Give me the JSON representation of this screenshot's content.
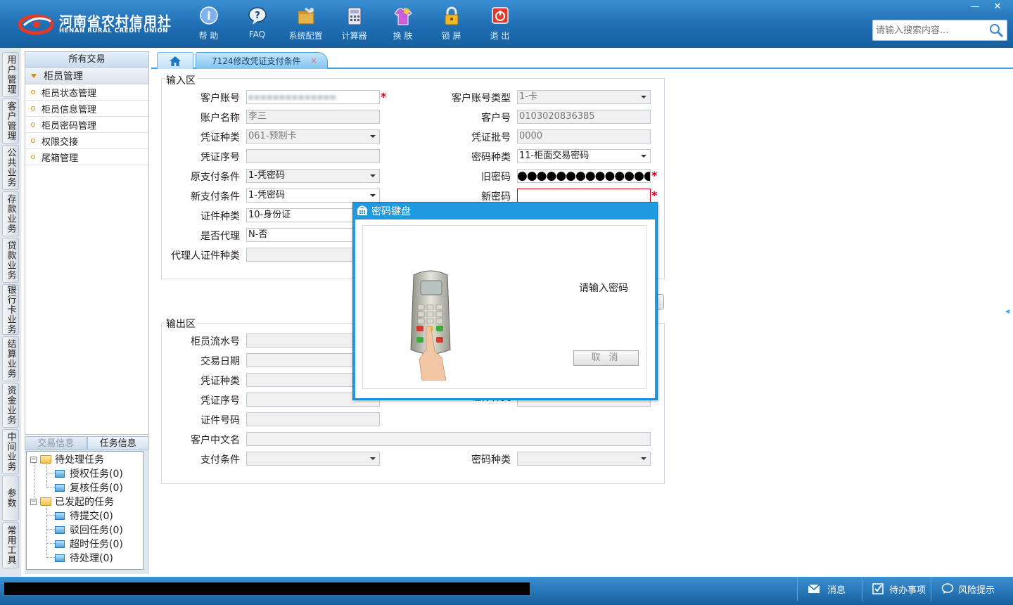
{
  "header": {
    "logo_cn": "河南省农村信用社",
    "logo_en": "HENAN RURAL CREDIT UNION",
    "toolbar": [
      {
        "label": "帮 助",
        "icon": "help-icon"
      },
      {
        "label": "FAQ",
        "icon": "faq-icon"
      },
      {
        "label": "系统配置",
        "icon": "config-icon"
      },
      {
        "label": "计算器",
        "icon": "calculator-icon"
      },
      {
        "label": "换 肤",
        "icon": "skin-icon"
      },
      {
        "label": "锁 屏",
        "icon": "lock-icon"
      },
      {
        "label": "退 出",
        "icon": "power-icon"
      }
    ],
    "window_min": "—",
    "window_close": "✕",
    "search_placeholder": "请输入搜索内容..."
  },
  "rail": [
    "用户管理",
    "客户管理",
    "公共业务",
    "存款业务",
    "贷款业务",
    "银行卡业务",
    "结算业务",
    "资金业务",
    "中间业务",
    "参数",
    "常用工具"
  ],
  "nav": {
    "header": "所有交易",
    "group": "柜员管理",
    "items": [
      "柜员状态管理",
      "柜员信息管理",
      "柜员密码管理",
      "权限交接",
      "尾箱管理"
    ]
  },
  "task": {
    "tabs": [
      "交易信息",
      "任务信息"
    ],
    "pending": "待处理任务",
    "auth": "授权任务(0)",
    "review": "复核任务(0)",
    "initiated": "已发起的任务",
    "to_submit": "待提交(0)",
    "rejected": "驳回任务(0)",
    "timeout": "超时任务(0)",
    "to_process": "待处理(0)"
  },
  "tabs": {
    "current": "7124修改凭证支付条件",
    "close": "×"
  },
  "input": {
    "title": "输入区",
    "cust_account_label": "客户账号",
    "cust_account_type_label": "客户账号类型",
    "cust_account_type": "1-卡",
    "account_name_label": "账户名称",
    "account_name": "李三",
    "cust_no_label": "客户号",
    "cust_no": "0103020836385",
    "voucher_type_label": "凭证种类",
    "voucher_type": "061-预制卡",
    "voucher_batch_label": "凭证批号",
    "voucher_batch": "0000",
    "voucher_seq_label": "凭证序号",
    "voucher_seq": "",
    "pwd_type_label": "密码种类",
    "pwd_type": "11-柜面交易密码",
    "orig_pay_label": "原支付条件",
    "orig_pay": "1-凭密码",
    "old_pwd_label": "旧密码",
    "old_pwd": "●●●●●●●●●●●●●●●",
    "new_pay_label": "新支付条件",
    "new_pay": "1-凭密码",
    "new_pwd_label": "新密码",
    "new_pwd": "",
    "id_type_label": "证件种类",
    "id_type": "10-身份证",
    "is_agent_label": "是否代理",
    "is_agent": "N-否",
    "agent_id_type_label": "代理人证件种类",
    "agent_id_type": "",
    "required_mark": "*"
  },
  "output": {
    "title": "输出区",
    "teller_serial_label": "柜员流水号",
    "trade_date_label": "交易日期",
    "voucher_type_label": "凭证种类",
    "voucher_seq_label": "凭证序号",
    "id_type_partial_label": "证件种类",
    "id_no_label": "证件号码",
    "cust_cn_name_label": "客户中文名",
    "pay_cond_label": "支付条件",
    "pwd_type_label": "密码种类"
  },
  "dialog": {
    "title": "密码键盘",
    "message": "请输入密码",
    "cancel": "取 消"
  },
  "statusbar": {
    "message": "消息",
    "todo": "待办事项",
    "risk": "风险提示"
  },
  "colors": {
    "header_blue": "#1f6db3",
    "dialog_blue": "#1f9ae0",
    "required_red": "#d0021b"
  }
}
